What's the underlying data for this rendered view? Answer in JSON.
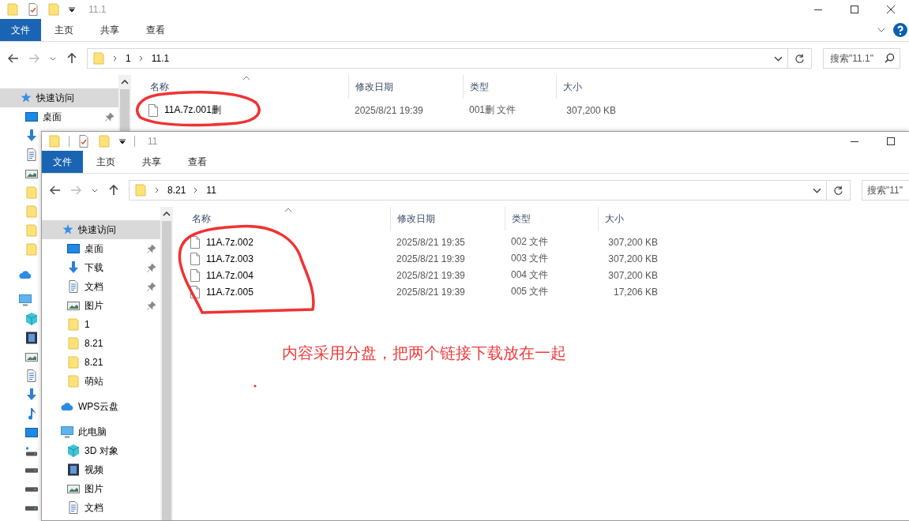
{
  "windows": [
    {
      "title": "11.1",
      "ribbon": [
        {
          "label": "文件",
          "kind": "menu"
        },
        {
          "label": "主页",
          "kind": "tab"
        },
        {
          "label": "共享",
          "kind": "tab"
        },
        {
          "label": "查看",
          "kind": "tab"
        }
      ],
      "path": [
        "1",
        "11.1"
      ],
      "search": {
        "placeholder": "搜索\"11.1\""
      },
      "sidebar": [
        {
          "label": "快速访问",
          "kind": "star",
          "selected": true,
          "children": [
            {
              "label": "桌面",
              "kind": "desktop",
              "selected": false,
              "pinned": true
            },
            {
              "kind": "download",
              "selected": false
            },
            {
              "kind": "document",
              "selected": false
            },
            {
              "kind": "picture",
              "selected": false
            },
            {
              "kind": "folder",
              "selected": false
            },
            {
              "kind": "folder",
              "selected": false
            },
            {
              "kind": "folder",
              "selected": false
            },
            {
              "kind": "folder",
              "selected": false
            }
          ]
        },
        {
          "kind": "cloud",
          "selected": false
        },
        {
          "kind": "pc",
          "selected": false,
          "children": [
            {
              "kind": "cube",
              "selected": false
            },
            {
              "kind": "video",
              "selected": false
            },
            {
              "kind": "picture",
              "selected": false
            },
            {
              "kind": "document",
              "selected": false
            },
            {
              "kind": "download",
              "selected": false
            },
            {
              "kind": "music",
              "selected": false
            },
            {
              "kind": "desktop",
              "selected": false
            },
            {
              "kind": "netdrive",
              "selected": false
            },
            {
              "kind": "drive",
              "selected": false
            },
            {
              "kind": "drive",
              "selected": false
            },
            {
              "kind": "drive",
              "selected": false
            }
          ]
        }
      ],
      "columns": [
        "名称",
        "修改日期",
        "类型",
        "大小"
      ],
      "files": [
        {
          "name": "11A.7z.001删",
          "date": "2025/8/21 19:39",
          "type": "001删 文件",
          "size": "307,200 KB"
        }
      ]
    },
    {
      "title": "11",
      "ribbon": [
        {
          "label": "文件",
          "kind": "menu"
        },
        {
          "label": "主页",
          "kind": "tab"
        },
        {
          "label": "共享",
          "kind": "tab"
        },
        {
          "label": "查看",
          "kind": "tab"
        }
      ],
      "path": [
        "8.21",
        "11"
      ],
      "search": {
        "placeholder": "搜索\"11\""
      },
      "sidebar": [
        {
          "label": "快速访问",
          "kind": "star",
          "selected": true,
          "children": [
            {
              "label": "桌面",
              "kind": "desktop",
              "selected": false,
              "pinned": true
            },
            {
              "label": "下载",
              "kind": "download",
              "selected": false,
              "pinned": true
            },
            {
              "label": "文档",
              "kind": "document",
              "selected": false,
              "pinned": true
            },
            {
              "label": "图片",
              "kind": "picture",
              "selected": false,
              "pinned": true
            },
            {
              "label": "1",
              "kind": "folder",
              "selected": false,
              "pinned": false
            },
            {
              "label": "8.21",
              "kind": "folder",
              "selected": false,
              "pinned": false
            },
            {
              "label": "8.21",
              "kind": "folder",
              "selected": false,
              "pinned": false
            },
            {
              "label": "萌站",
              "kind": "folder",
              "selected": false,
              "pinned": false
            }
          ]
        },
        {
          "label": "WPS云盘",
          "kind": "cloud",
          "selected": false
        },
        {
          "label": "此电脑",
          "kind": "pc",
          "selected": false,
          "children": [
            {
              "label": "3D 对象",
              "kind": "cube",
              "selected": false
            },
            {
              "label": "视频",
              "kind": "video",
              "selected": false
            },
            {
              "label": "图片",
              "kind": "picture",
              "selected": false
            },
            {
              "label": "文档",
              "kind": "document",
              "selected": false
            }
          ]
        }
      ],
      "columns": [
        "名称",
        "修改日期",
        "类型",
        "大小"
      ],
      "files": [
        {
          "name": "11A.7z.002",
          "date": "2025/8/21 19:35",
          "type": "002 文件",
          "size": "307,200 KB"
        },
        {
          "name": "11A.7z.003",
          "date": "2025/8/21 19:39",
          "type": "003 文件",
          "size": "307,200 KB"
        },
        {
          "name": "11A.7z.004",
          "date": "2025/8/21 19:39",
          "type": "004 文件",
          "size": "307,200 KB"
        },
        {
          "name": "11A.7z.005",
          "date": "2025/8/21 19:39",
          "type": "005 文件",
          "size": "17,206 KB"
        }
      ]
    }
  ],
  "annotation": {
    "note": "内容采用分盘，把两个链接下载放在一起"
  }
}
